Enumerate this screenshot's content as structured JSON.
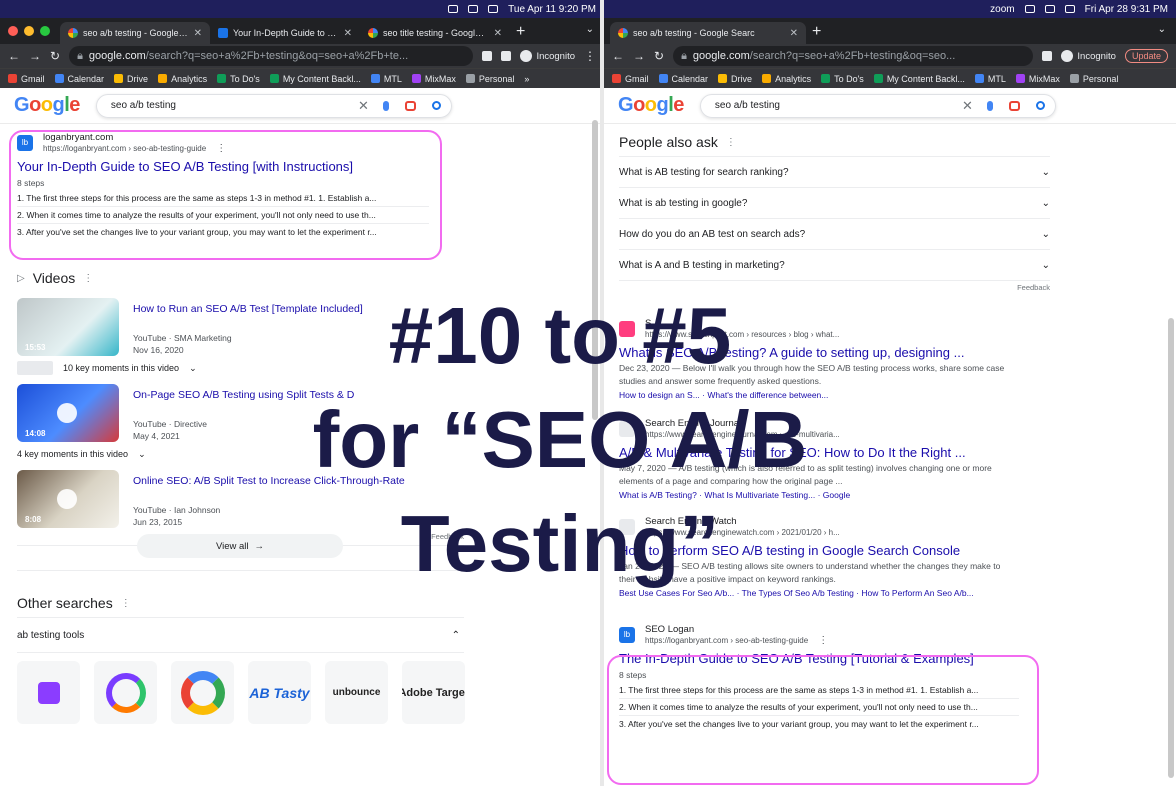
{
  "left": {
    "menubar": {
      "datetime": "Tue Apr 11  9:20 PM"
    },
    "tabs": [
      {
        "title": "seo a/b testing - Google Sear",
        "active": true
      },
      {
        "title": "Your In-Depth Guide to SEO A/",
        "active": false
      },
      {
        "title": "seo title testing - Google Se",
        "active": false
      }
    ],
    "address": {
      "host": "google.com",
      "path": "/search?q=seo+a%2Fb+testing&oq=seo+a%2Fb+te...",
      "incognito": "Incognito"
    },
    "bookmarks": [
      "Gmail",
      "Calendar",
      "Drive",
      "Analytics",
      "To Do's",
      "My Content Backl...",
      "MTL",
      "MixMax",
      "Personal"
    ],
    "search": {
      "query": "seo a/b testing"
    },
    "result1": {
      "site": "loganbryant.com",
      "url": "https://loganbryant.com › seo-ab-testing-guide",
      "title": "Your In-Depth Guide to SEO A/B Testing [with Instructions]",
      "steps": "8 steps",
      "items": [
        "1.  The first three steps for this process are the same as steps 1-3 in method #1. 1. Establish a...",
        "2.  When it comes time to analyze the results of your experiment, you'll not only need to use th...",
        "3.  After you've set the changes live to your variant group, you may want to let the experiment r..."
      ]
    },
    "videos": {
      "heading": "Videos",
      "items": [
        {
          "title": "How to Run an SEO A/B Test [Template Included]",
          "source": "YouTube · SMA Marketing",
          "date": "Nov 16, 2020",
          "duration": "15:53",
          "moments": "10 key moments in this video"
        },
        {
          "title": "On-Page SEO A/B Testing using Split Tests & D",
          "source": "YouTube · Directive",
          "date": "May 4, 2021",
          "duration": "14:08",
          "moments": "4 key moments in this video"
        },
        {
          "title": "Online SEO: A/B Split Test to Increase Click-Through-Rate",
          "source": "YouTube · Ian Johnson",
          "date": "Jun 23, 2015",
          "duration": "8:08",
          "moments": ""
        }
      ],
      "feedback": "Feedback",
      "view_all": "View all"
    },
    "other": {
      "heading": "Other searches",
      "item": "ab testing tools",
      "logos": [
        "",
        "",
        "",
        "AB Tasty",
        "unbounce",
        "Adobe Target"
      ]
    }
  },
  "right": {
    "menubar": {
      "zoom": "zoom",
      "datetime": "Fri Apr 28  9:31 PM"
    },
    "tabs": [
      {
        "title": "seo a/b testing - Google Searc",
        "active": true
      }
    ],
    "address": {
      "host": "google.com",
      "path": "/search?q=seo+a%2Fb+testing&oq=seo...",
      "incognito": "Incognito",
      "update": "Update"
    },
    "bookmarks": [
      "Gmail",
      "Calendar",
      "Drive",
      "Analytics",
      "To Do's",
      "My Content Backl...",
      "MTL",
      "MixMax",
      "Personal"
    ],
    "search": {
      "query": "seo a/b testing"
    },
    "paa": {
      "heading": "People also ask",
      "questions": [
        "What is AB testing for search ranking?",
        "What is ab testing in google?",
        "How do you do an AB test on search ads?",
        "What is A and B testing in marketing?"
      ],
      "feedback": "Feedback"
    },
    "results": [
      {
        "site": "S",
        "url": "https://www.searchpilot.com › resources › blog › what...",
        "title": "What is SEO A/B testing? A guide to setting up, designing ...",
        "snippet": "Dec 23, 2020 — Below I'll walk you through how the SEO A/B testing process works, share some case studies and answer some frequently asked questions.",
        "sub": "How to design an S... · What's the difference between..."
      },
      {
        "site": "Search Engine Journal",
        "url": "https://www.searchenginejournal.com › a-b-multivaria...",
        "title": "A/B & Multivariate Testing for SEO: How to Do It the Right ...",
        "snippet": "May 7, 2020 — A/B testing (which is also referred to as split testing) involves changing one or more elements of a page and comparing how the original page ...",
        "sub": "What is A/B Testing? · What Is Multivariate Testing... · Google"
      },
      {
        "site": "Search Engine Watch",
        "url": "https://www.searchenginewatch.com › 2021/01/20 › h...",
        "title": "How to perform SEO A/B testing in Google Search Console",
        "snippet": "Jan 20, 2021 — SEO A/B testing allows site owners to understand whether the changes they make to their website have a positive impact on keyword rankings.",
        "sub": "Best Use Cases For Seo A/b... · The Types Of Seo A/b Testing · How To Perform An Seo A/b..."
      }
    ],
    "highlight": {
      "site": "SEO Logan",
      "url": "https://loganbryant.com › seo-ab-testing-guide",
      "title": "The In-Depth Guide to SEO A/B Testing [Tutorial & Examples]",
      "steps": "8 steps",
      "items": [
        "1.  The first three steps for this process are the same as steps 1-3 in method #1. 1. Establish a...",
        "2.  When it comes time to analyze the results of your experiment, you'll not only need to use th...",
        "3.  After you've set the changes live to your variant group, you may want to let the experiment r..."
      ]
    }
  },
  "overlay": {
    "line1": "#10 to #5",
    "line2": "for “SEO A/B",
    "line3": "Testing”"
  },
  "colors": {
    "link": "#1a0dab",
    "highlight": "#f26bf0",
    "overlay": "#1b1b48",
    "menubar": "#1f1f5c"
  }
}
